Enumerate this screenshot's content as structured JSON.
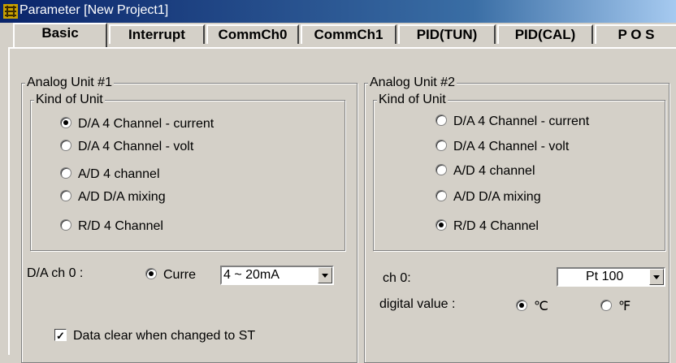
{
  "window": {
    "title": "Parameter [New Project1]",
    "title_color": "#ffffff",
    "title_bar_color": "#0a246a"
  },
  "tabs": [
    {
      "label": "Basic",
      "active": true
    },
    {
      "label": "Interrupt",
      "active": false
    },
    {
      "label": "CommCh0",
      "active": false
    },
    {
      "label": "CommCh1",
      "active": false
    },
    {
      "label": "PID(TUN)",
      "active": false
    },
    {
      "label": "PID(CAL)",
      "active": false
    },
    {
      "label": "P O S",
      "active": false
    }
  ],
  "unit1": {
    "title": "Analog Unit #1",
    "kind_title": "Kind of Unit",
    "options": [
      {
        "label": "D/A 4 Channel - current",
        "selected": true
      },
      {
        "label": "D/A 4 Channel - volt",
        "selected": false
      },
      {
        "label": "A/D 4 channel",
        "selected": false
      },
      {
        "label": "A/D D/A mixing",
        "selected": false
      },
      {
        "label": "R/D 4 Channel",
        "selected": false
      }
    ],
    "channel_label": "D/A ch 0 :",
    "mode_radio_label": "Curre",
    "range_value": "4 ~ 20mA",
    "checkbox_label": "Data clear when changed to ST",
    "checkbox_checked": true
  },
  "unit2": {
    "title": "Analog Unit #2",
    "kind_title": "Kind of Unit",
    "options": [
      {
        "label": "D/A 4 Channel - current",
        "selected": false
      },
      {
        "label": "D/A 4 Channel - volt",
        "selected": false
      },
      {
        "label": "A/D 4 channel",
        "selected": false
      },
      {
        "label": "A/D D/A mixing",
        "selected": false
      },
      {
        "label": "R/D 4 Channel",
        "selected": true
      }
    ],
    "channel_label": "ch  0:",
    "sensor_value": "Pt 100",
    "digital_label": "digital value :",
    "unit_celsius": "℃",
    "unit_fahrenheit": "℉",
    "selected_unit": "celsius"
  }
}
